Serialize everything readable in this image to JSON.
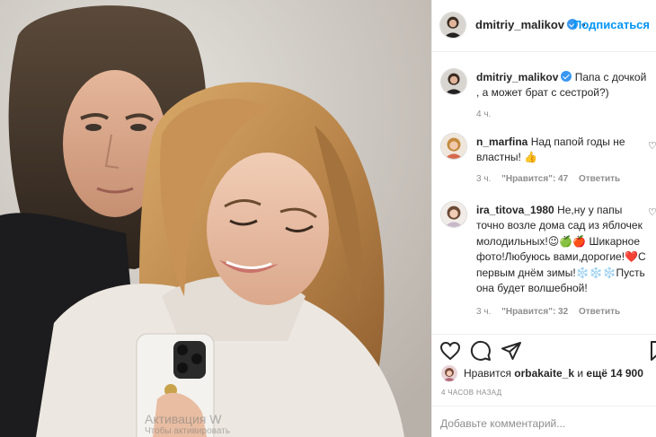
{
  "post": {
    "author": "dmitriy_malikov",
    "follow_label": "Подписаться",
    "separator": "•"
  },
  "caption": {
    "user": "dmitriy_malikov",
    "text": "Папа с дочкой , а может брат с сестрой?)",
    "time": "4 ч."
  },
  "comments": [
    {
      "user": "n_marfina",
      "text": "Над папой годы не властны! 👍",
      "time": "3 ч.",
      "likes": "\"Нравится\": 47",
      "reply": "Ответить"
    },
    {
      "user": "ira_titova_1980",
      "text": "Не,ну у папы точно возле дома сад из яблочек молодильных!😉🍏🍎 Шикарное фото!Любуюсь вами,дорогие!❤️С первым днём зимы!❄️❄️❄️Пусть она будет волшебной!",
      "time": "3 ч.",
      "likes": "\"Нравится\": 32",
      "reply": "Ответить"
    }
  ],
  "likes": {
    "prefix": "Нравится",
    "user": "orbakaite_k",
    "connector": "и",
    "rest": "ещё 14 900"
  },
  "timeago": "4 ЧАСОВ НАЗАД",
  "add_comment": {
    "placeholder": "Добавьте комментарий..."
  },
  "watermark": {
    "line1": "Активация W",
    "line2": "Чтобы активировать"
  },
  "icons": {
    "like": "heart-icon",
    "comment": "comment-icon",
    "share": "share-icon",
    "save": "bookmark-icon",
    "verified": "verified-badge-icon"
  },
  "colors": {
    "link": "#0095f6",
    "verified": "#3897f0",
    "muted": "#8e8e8e",
    "text": "#262626"
  }
}
